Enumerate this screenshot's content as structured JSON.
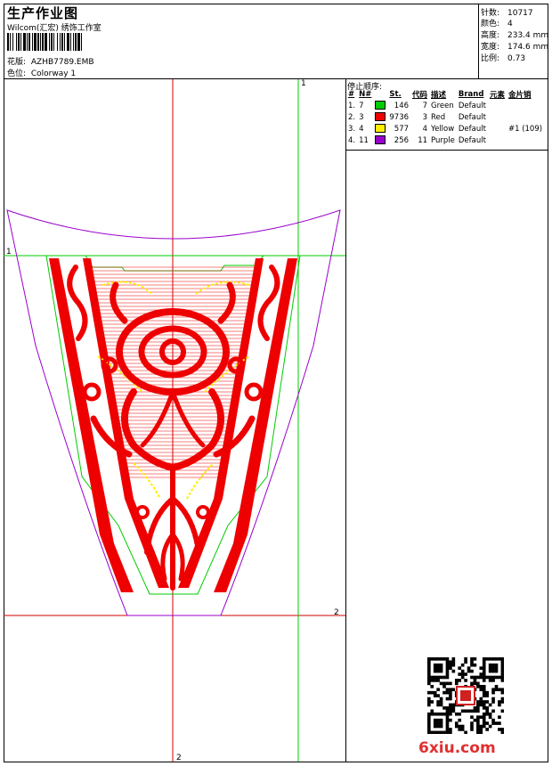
{
  "header": {
    "title": "生产作业图",
    "company": "Wilcom(汇宏) 绣饰工作室"
  },
  "design_info": {
    "pattern_label": "花版:",
    "pattern_value": "AZHB7789.EMB",
    "colorway_label": "色位:",
    "colorway_value": "Colorway 1"
  },
  "stats": [
    {
      "label": "针数:",
      "value": "10717"
    },
    {
      "label": "颜色:",
      "value": "4"
    },
    {
      "label": "高度:",
      "value": "233.4 mm"
    },
    {
      "label": "宽度:",
      "value": "174.6 mm"
    },
    {
      "label": "比例:",
      "value": "0.73"
    }
  ],
  "stop_sequence": {
    "title": "停止顺序:",
    "columns": [
      "#",
      "N#",
      "",
      "St.",
      "代码",
      "描述",
      "Brand",
      "元素",
      "金片销"
    ],
    "rows": [
      {
        "idx": "1.",
        "n": "7",
        "color": "#00cc00",
        "st": "146",
        "code": "7",
        "desc": "Green",
        "brand": "Default",
        "element": "",
        "sequin": ""
      },
      {
        "idx": "2.",
        "n": "3",
        "color": "#ee0000",
        "st": "9736",
        "code": "3",
        "desc": "Red",
        "brand": "Default",
        "element": "",
        "sequin": ""
      },
      {
        "idx": "3.",
        "n": "4",
        "color": "#ffee00",
        "st": "577",
        "code": "4",
        "desc": "Yellow",
        "brand": "Default",
        "element": "",
        "sequin": "#1 (109)"
      },
      {
        "idx": "4.",
        "n": "11",
        "color": "#9900cc",
        "st": "256",
        "code": "11",
        "desc": "Purple",
        "brand": "Default",
        "element": "",
        "sequin": ""
      }
    ]
  },
  "markers": {
    "top_right": "1",
    "left": "1",
    "right": "2",
    "bottom": "2"
  },
  "footer": {
    "logo_text": "6xiu.com"
  },
  "colors": {
    "green": "#00cc00",
    "red": "#ee0000",
    "yellow": "#ffee00",
    "purple": "#9900cc"
  }
}
